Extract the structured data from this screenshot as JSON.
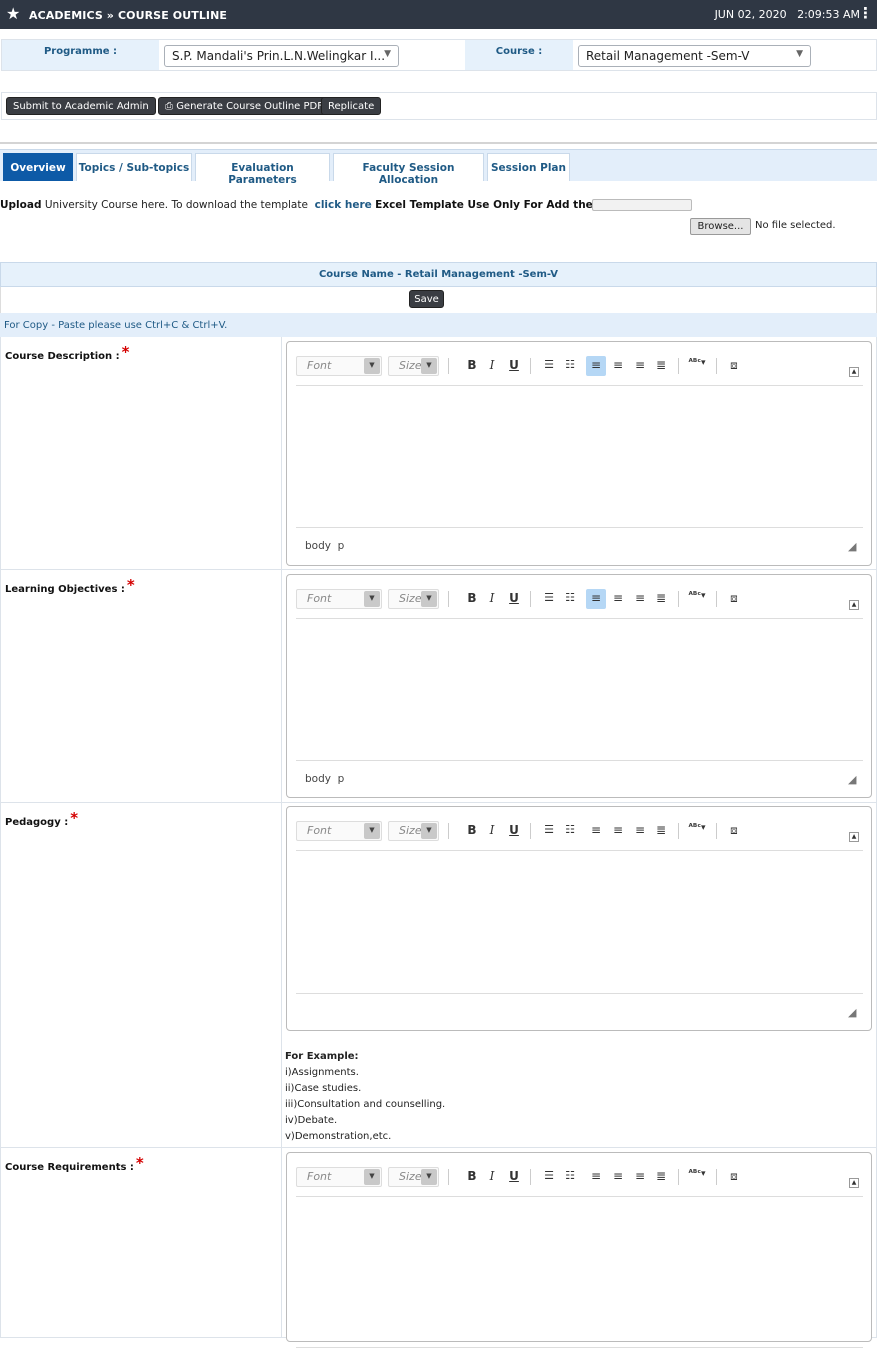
{
  "header": {
    "title": "ACADEMICS » COURSE OUTLINE",
    "date": "JUN 02, 2020",
    "time": "2:09:53 AM"
  },
  "filters": {
    "programme_label": "Programme :",
    "programme_value": "S.P. Mandali's Prin.L.N.Welingkar I...",
    "course_label": "Course :",
    "course_value": "Retail Management -Sem-V"
  },
  "actions": {
    "submit": "Submit to Academic Admin",
    "generate_pdf": "Generate Course Outline PDF",
    "replicate": "Replicate"
  },
  "tabs": [
    {
      "label": "Overview"
    },
    {
      "label": "Topics / Sub-topics"
    },
    {
      "label": "Evaluation Parameters"
    },
    {
      "label": "Faculty Session Allocation"
    },
    {
      "label": "Session Plan"
    }
  ],
  "upload": {
    "prefix": "Upload",
    "text1": "University Course here. To download the template",
    "link": "click here",
    "text2": "Excel Template Use Only For Add the Course Outline .",
    "browse": "Browse...",
    "no_file": "No file selected."
  },
  "course_header": "Course Name - Retail Management -Sem-V",
  "save_label": "Save",
  "copy_note": "For Copy - Paste please use Ctrl+C & Ctrl+V.",
  "editor_ui": {
    "font_placeholder": "Font",
    "size_placeholder": "Size",
    "path_body": "body",
    "path_p": "p"
  },
  "fields": [
    {
      "label": "Course Description :"
    },
    {
      "label": "Learning Objectives :"
    },
    {
      "label": "Pedagogy :"
    },
    {
      "label": "Course Requirements :"
    }
  ],
  "pedagogy_example": {
    "title": "For Example:",
    "items": [
      "i)Assignments.",
      "ii)Case studies.",
      "iii)Consultation and counselling.",
      "iv)Debate.",
      "v)Demonstration,etc."
    ]
  },
  "required_mark": "*"
}
